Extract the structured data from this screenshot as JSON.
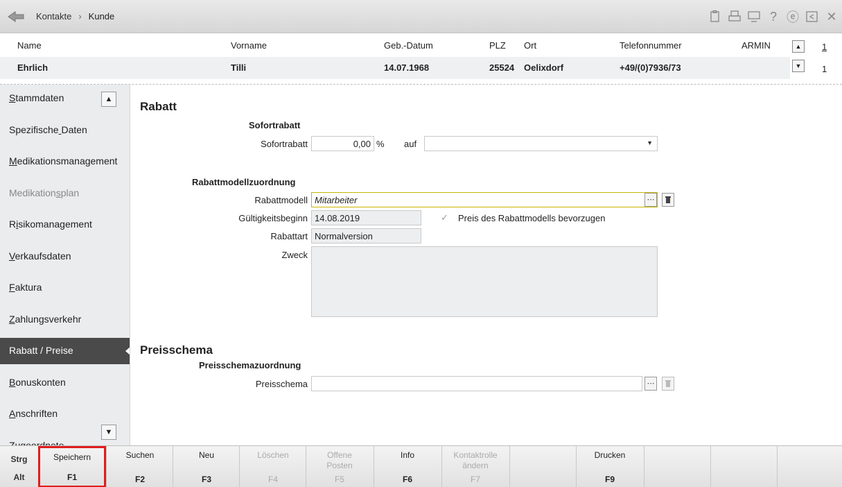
{
  "titlebar": {
    "breadcrumb": [
      "Kontakte",
      "Kunde"
    ],
    "separator": "›",
    "icons": [
      "clipboard-icon",
      "printer-icon",
      "monitor-icon",
      "help-icon",
      "e-icon",
      "window-icon",
      "close-icon"
    ],
    "help_glyph": "?",
    "close_glyph": "✕",
    "e_glyph": "ⓔ"
  },
  "customer": {
    "headers": {
      "name": "Name",
      "vorname": "Vorname",
      "geb": "Geb.-Datum",
      "plz": "PLZ",
      "ort": "Ort",
      "telefon": "Telefonnummer",
      "armin": "ARMIN"
    },
    "values": {
      "name": "Ehrlich",
      "vorname": "Tilli",
      "geb": "14.07.1968",
      "plz": "25524",
      "ort": "Oelixdorf",
      "telefon": "+49/(0)7936/73"
    },
    "page_top": "1",
    "page_bottom": "1"
  },
  "sidebar": {
    "items": [
      {
        "label": "Stammdaten",
        "u": 0
      },
      {
        "label": "Spezifische Daten",
        "u": 11
      },
      {
        "label": "Medikationsmanagement",
        "u": 0
      },
      {
        "label": "Medikationsplan",
        "u": 10,
        "disabled": true
      },
      {
        "label": "Risikomanagement",
        "u": 1
      },
      {
        "label": "Verkaufsdaten",
        "u": 0
      },
      {
        "label": "Faktura",
        "u": 0
      },
      {
        "label": "Zahlungsverkehr",
        "u": 0
      },
      {
        "label": "Rabatt / Preise",
        "active": true
      },
      {
        "label": "Bonuskonten",
        "u": 0
      },
      {
        "label": "Anschriften",
        "u": 0
      },
      {
        "label": "Zugeordnete",
        "u": 0
      }
    ]
  },
  "rabatt": {
    "title": "Rabatt",
    "sofort_title": "Sofortrabatt",
    "sofort_label": "Sofortrabatt",
    "sofort_value": "0,00",
    "percent": "%",
    "auf_label": "auf",
    "auf_value": "",
    "modell_title": "Rabattmodellzuordnung",
    "modell_label": "Rabattmodell",
    "modell_value": "Mitarbeiter",
    "beginn_label": "Gültigkeitsbeginn",
    "beginn_value": "14.08.2019",
    "prefer_label": "Preis des Rabattmodells bevorzugen",
    "art_label": "Rabattart",
    "art_value": "Normalversion",
    "zweck_label": "Zweck",
    "zweck_value": ""
  },
  "preisschema": {
    "title": "Preisschema",
    "sub_title": "Preisschemazuordnung",
    "label": "Preisschema",
    "value": ""
  },
  "fbar": {
    "mod_strg": "Strg",
    "mod_alt": "Alt",
    "keys": [
      {
        "label": "Speichern",
        "key": "F1",
        "highlight": true
      },
      {
        "label": "Suchen",
        "key": "F2"
      },
      {
        "label": "Neu",
        "key": "F3"
      },
      {
        "label": "Löschen",
        "key": "F4",
        "disabled": true
      },
      {
        "label": "Offene\nPosten",
        "key": "F5",
        "disabled": true
      },
      {
        "label": "Info",
        "key": "F6"
      },
      {
        "label": "Kontaktrolle\nändern",
        "key": "F7",
        "disabled": true
      },
      {
        "label": "",
        "key": ""
      },
      {
        "label": "Drucken",
        "key": "F9"
      },
      {
        "label": "",
        "key": ""
      },
      {
        "label": "",
        "key": ""
      },
      {
        "label": "",
        "key": ""
      }
    ]
  },
  "colors": {
    "active_sidebar": "#4a4a4a",
    "highlight": "#e01d1d",
    "focus_border": "#c8b400"
  }
}
